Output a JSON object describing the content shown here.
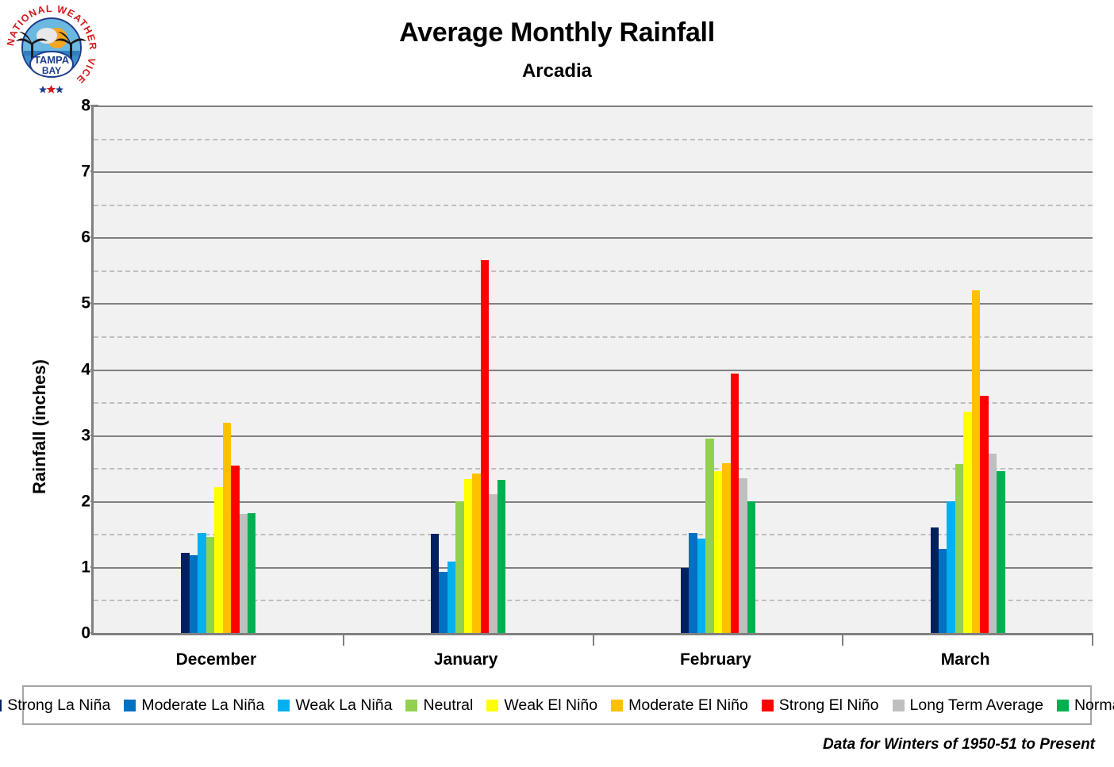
{
  "header": {
    "title": "Average Monthly Rainfall",
    "subtitle": "Arcadia",
    "logo_alt": "National Weather Service Tampa Bay",
    "logo_text_top": "NATIONAL WEATHER SERVICE",
    "logo_text_inner1": "TAMPA",
    "logo_text_inner2": "BAY"
  },
  "footer": {
    "note": "Data for Winters of 1950-51 to Present"
  },
  "axis": {
    "y_label": "Rainfall (inches)",
    "y_ticks": [
      "0",
      "1",
      "2",
      "3",
      "4",
      "5",
      "6",
      "7",
      "8"
    ]
  },
  "chart_data": {
    "type": "bar",
    "title": "Average Monthly Rainfall",
    "subtitle": "Arcadia",
    "xlabel": "",
    "ylabel": "Rainfall (inches)",
    "ylim": [
      0,
      8
    ],
    "ytick_step": 1,
    "yminor_step": 0.5,
    "grid": true,
    "legend_position": "bottom",
    "categories": [
      "December",
      "January",
      "February",
      "March"
    ],
    "series": [
      {
        "name": "Strong La Niña",
        "color": "#002060",
        "values": [
          1.22,
          1.5,
          0.99,
          1.6
        ]
      },
      {
        "name": "Moderate La Niña",
        "color": "#0070C0",
        "values": [
          1.18,
          0.93,
          1.51,
          1.27
        ]
      },
      {
        "name": "Weak La Niña",
        "color": "#00B0F0",
        "values": [
          1.51,
          1.08,
          1.43,
          2.0
        ]
      },
      {
        "name": "Neutral",
        "color": "#92D050",
        "values": [
          1.45,
          2.0,
          2.95,
          2.56
        ]
      },
      {
        "name": "Weak El Niño",
        "color": "#FFFF00",
        "values": [
          2.21,
          2.34,
          2.46,
          3.36
        ]
      },
      {
        "name": "Moderate El Niño",
        "color": "#FFC000",
        "values": [
          3.19,
          2.42,
          2.58,
          5.2
        ]
      },
      {
        "name": "Strong El Niño",
        "color": "#FF0000",
        "values": [
          2.54,
          5.65,
          3.93,
          3.6
        ]
      },
      {
        "name": "Long Term Average",
        "color": "#BFBFBF",
        "values": [
          1.8,
          2.11,
          2.35,
          2.72
        ]
      },
      {
        "name": "Normal",
        "color": "#00B050",
        "values": [
          1.82,
          2.32,
          2.0,
          2.45
        ]
      }
    ]
  }
}
